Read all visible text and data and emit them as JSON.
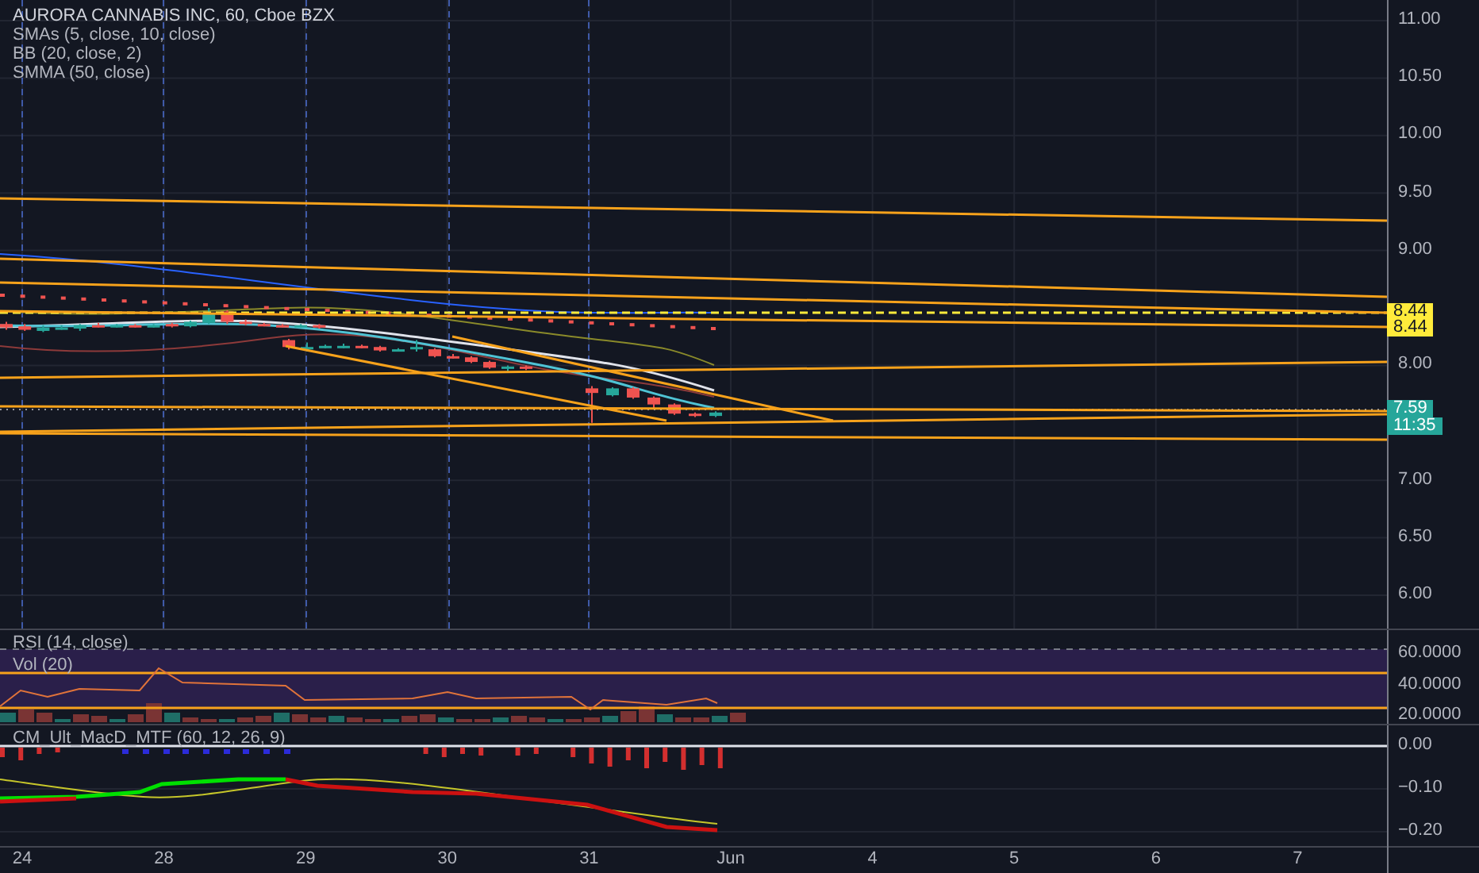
{
  "legend": {
    "title": "AURORA CANNABIS INC, 60, Cboe BZX",
    "indicators": [
      "SMAs (5, close, 10, close)",
      "BB (20, close, 2)",
      "SMMA (50, close)"
    ]
  },
  "price_axis": {
    "ticks": [
      "11.00",
      "10.50",
      "10.00",
      "9.50",
      "9.00",
      "8.00",
      "7.00",
      "6.50",
      "6.00"
    ],
    "labels": [
      {
        "text": "8.44",
        "kind": "alert"
      },
      {
        "text": "8.44",
        "kind": "alert"
      },
      {
        "text": "7.59",
        "kind": "price"
      },
      {
        "text": "11:35",
        "kind": "countdown"
      }
    ]
  },
  "lower_panes": [
    {
      "kind": "rsi_volume",
      "legend": [
        "RSI (14, close)",
        "Vol (20)"
      ],
      "ticks": [
        "60.0000",
        "40.0000",
        "20.0000"
      ]
    },
    {
      "kind": "macd",
      "legend": [
        "CM_Ult_MacD_MTF (60, 12, 26, 9)"
      ],
      "ticks": [
        "0.00",
        "−0.10",
        "−0.20"
      ]
    }
  ],
  "time_axis": [
    "24",
    "28",
    "29",
    "30",
    "31",
    "Jun",
    "4",
    "5",
    "6",
    "7"
  ]
}
